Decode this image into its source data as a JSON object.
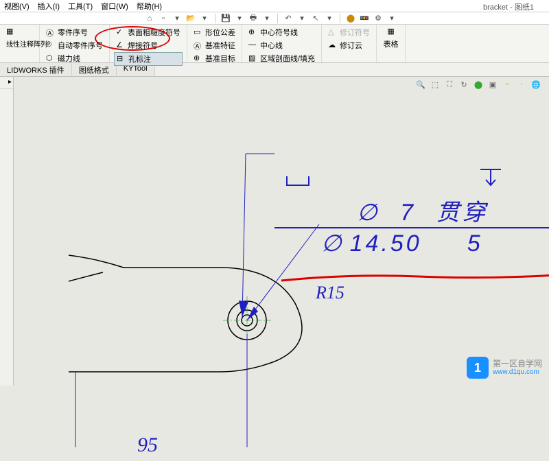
{
  "title": "bracket - 图纸1",
  "menubar": {
    "view": "视图(V)",
    "insert": "插入(I)",
    "tools": "工具(T)",
    "window": "窗口(W)",
    "help": "帮助(H)"
  },
  "ribbon": {
    "group1": {
      "item1": "线性注释阵列"
    },
    "group2": {
      "item1": "零件序号",
      "item2": "自动零件序号",
      "item3": "磁力线"
    },
    "group3": {
      "item1": "表面粗糙度符号",
      "item2": "焊接符号",
      "item3": "孔标注"
    },
    "group4": {
      "item1": "形位公差",
      "item2": "基准特征",
      "item3": "基准目标"
    },
    "group5": {
      "item1": "中心符号线",
      "item2": "中心线",
      "item3": "区域剖面线/填充"
    },
    "group6": {
      "item1": "修订符号",
      "item2": "修订云"
    },
    "group7": {
      "item1": "表格"
    }
  },
  "tabs": {
    "t1": "LIDWORKS 插件",
    "t2": "图纸格式",
    "t3": "KYTool"
  },
  "drawing": {
    "dim95": "95",
    "r15": "R15",
    "callout1_diam": "∅",
    "callout1_val": "7",
    "callout1_txt": "贯穿",
    "callout2_diam": "∅",
    "callout2_val": "14.50",
    "callout2_depth": "5"
  },
  "watermark": {
    "logo": "1",
    "name": "第一区自学网",
    "url": "www.d1qu.com"
  }
}
